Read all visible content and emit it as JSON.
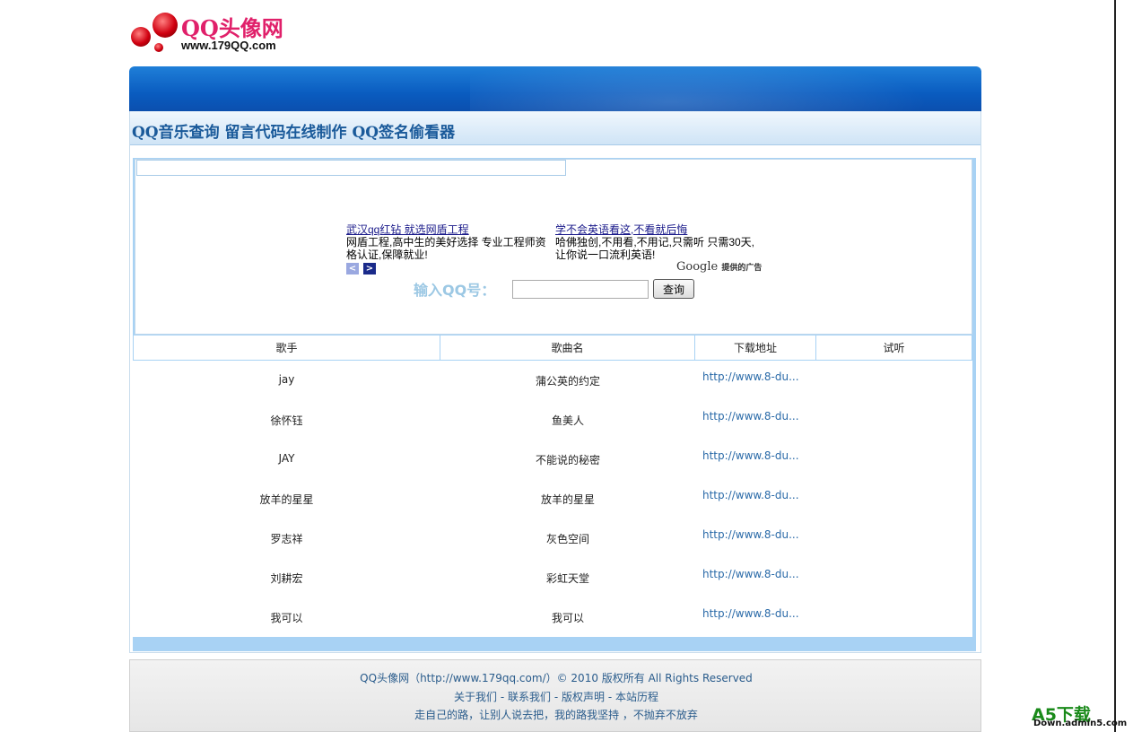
{
  "logo": {
    "title": "QQ头像网",
    "url": "www.179QQ.com"
  },
  "header": {
    "title": "QQ音乐查询 留言代码在线制作 QQ签名偷看器"
  },
  "ads": [
    {
      "title": "武汉qq红钻 就选网盾工程",
      "text": "网盾工程,高中生的美好选择 专业工程师资格认证,保障就业!"
    },
    {
      "title": "学不会英语看这,不看就后悔",
      "text": "哈佛独创,不用看,不用记,只需听 只需30天,让你说一口流利英语!"
    }
  ],
  "google": {
    "brand": "Google",
    "suffix": "提供的广告"
  },
  "search": {
    "label": "输入QQ号：",
    "value": "",
    "button": "查询"
  },
  "table": {
    "headers": [
      "歌手",
      "歌曲名",
      "下载地址",
      "试听"
    ],
    "rows": [
      {
        "singer": "jay",
        "song": "蒲公英的约定",
        "url": "http://www.8-du..."
      },
      {
        "singer": "徐怀钰",
        "song": "鱼美人",
        "url": "http://www.8-du..."
      },
      {
        "singer": "JAY",
        "song": "不能说的秘密",
        "url": "http://www.8-du..."
      },
      {
        "singer": "放羊的星星",
        "song": "放羊的星星",
        "url": "http://www.8-du..."
      },
      {
        "singer": "罗志祥",
        "song": "灰色空间",
        "url": "http://www.8-du..."
      },
      {
        "singer": "刘耕宏",
        "song": "彩虹天堂",
        "url": "http://www.8-du..."
      },
      {
        "singer": "我可以",
        "song": "我可以",
        "url": "http://www.8-du..."
      }
    ]
  },
  "footer": {
    "copyright": "QQ头像网（http://www.179qq.com/）© 2010 版权所有 All Rights Reserved",
    "links": [
      "关于我们",
      "联系我们",
      "版权声明",
      "本站历程"
    ],
    "sep": " - ",
    "motto": "走自己的路，让别人说去把，我的路我坚持 ，不抛弃不放弃"
  },
  "watermark": {
    "brand": "A5下载",
    "url": "Down.admin5.com"
  }
}
